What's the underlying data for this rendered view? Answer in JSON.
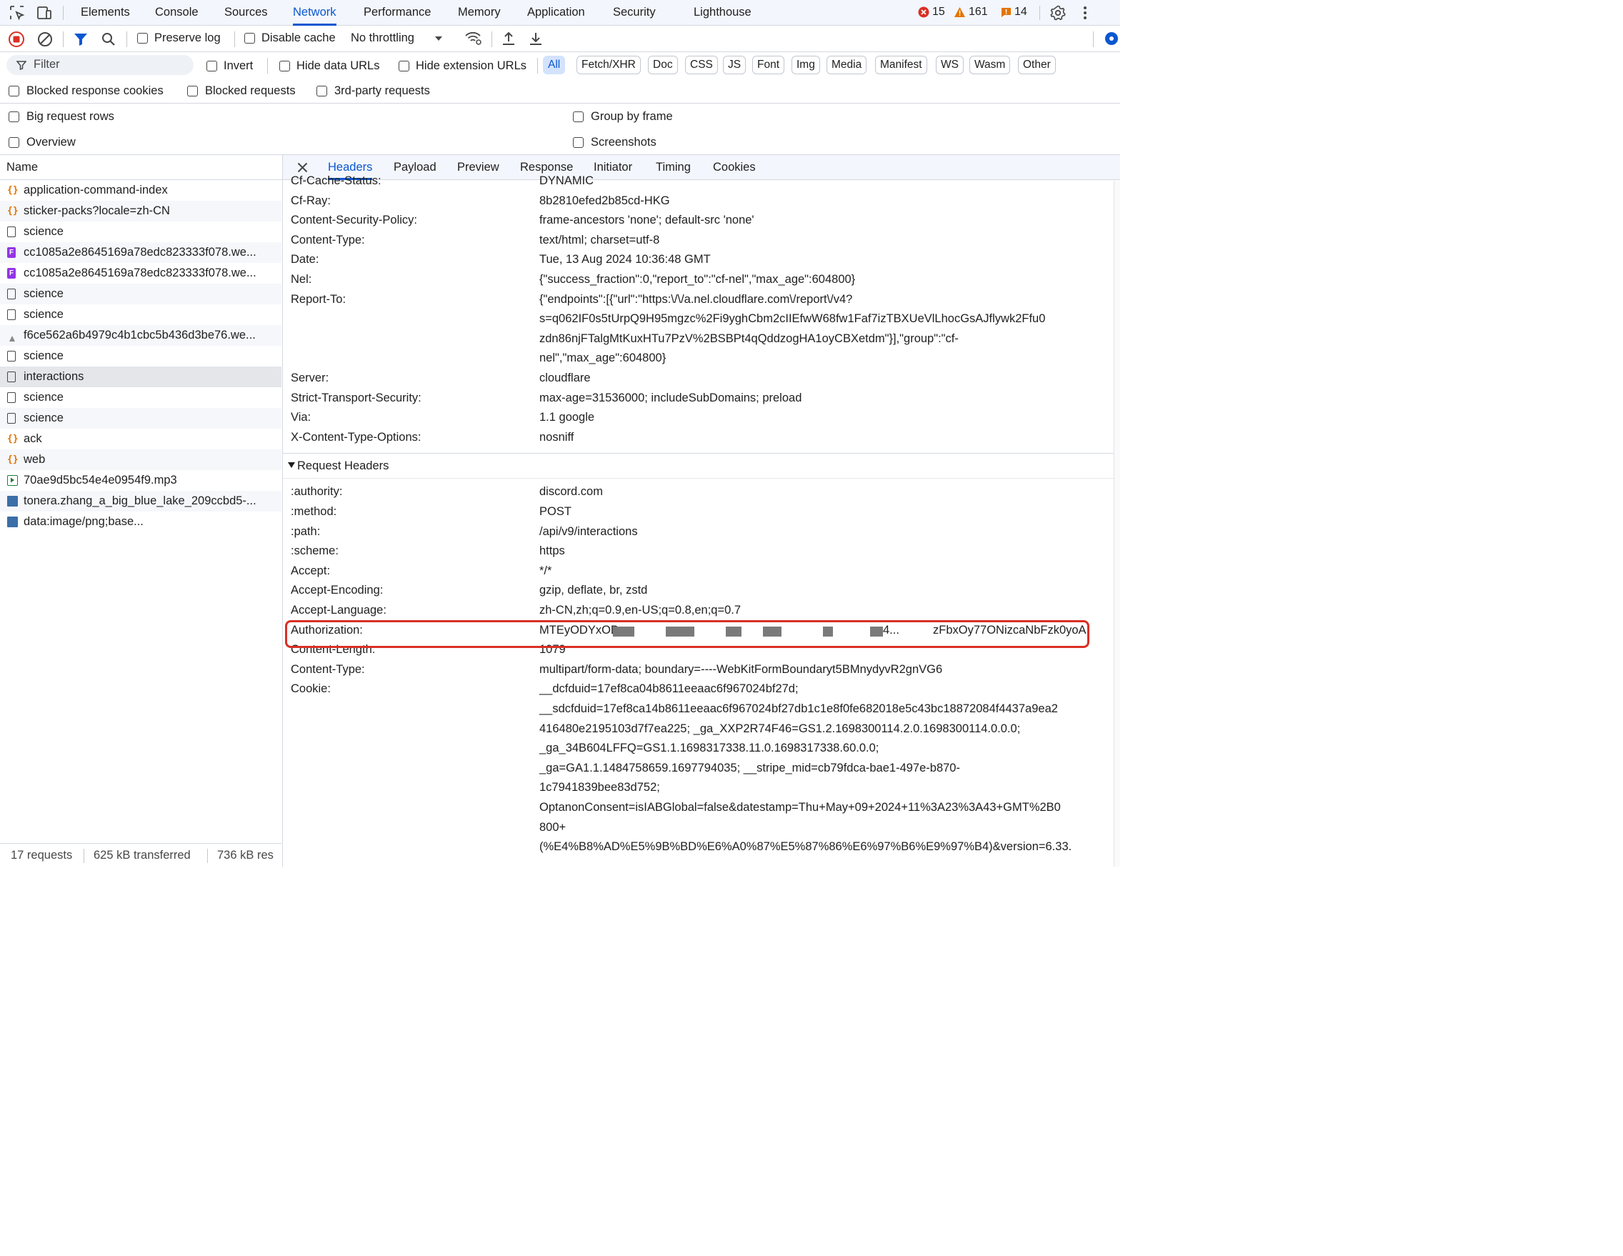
{
  "topbar": {
    "tabs": [
      "Elements",
      "Console",
      "Sources",
      "Network",
      "Performance",
      "Memory",
      "Application",
      "Security",
      "Lighthouse"
    ],
    "active_tab": "Network",
    "errors": "15",
    "warnings": "161",
    "issues": "14"
  },
  "toolbar": {
    "preserve_log": "Preserve log",
    "disable_cache": "Disable cache",
    "throttling": "No throttling"
  },
  "filter": {
    "placeholder": "Filter",
    "invert": "Invert",
    "hide_data_urls": "Hide data URLs",
    "hide_extension_urls": "Hide extension URLs",
    "types": [
      "All",
      "Fetch/XHR",
      "Doc",
      "CSS",
      "JS",
      "Font",
      "Img",
      "Media",
      "Manifest",
      "WS",
      "Wasm",
      "Other"
    ],
    "blocked_response_cookies": "Blocked response cookies",
    "blocked_requests": "Blocked requests",
    "third_party_requests": "3rd-party requests",
    "big_request_rows": "Big request rows",
    "group_by_frame": "Group by frame",
    "overview": "Overview",
    "screenshots": "Screenshots"
  },
  "requests": {
    "header": "Name",
    "items": [
      {
        "name": "application-command-index",
        "type": "xhr"
      },
      {
        "name": "sticker-packs?locale=zh-CN",
        "type": "xhr"
      },
      {
        "name": "science",
        "type": "doc"
      },
      {
        "name": "cc1085a2e8645169a78edc823333f078.we...",
        "type": "font"
      },
      {
        "name": "cc1085a2e8645169a78edc823333f078.we...",
        "type": "font"
      },
      {
        "name": "science",
        "type": "doc"
      },
      {
        "name": "science",
        "type": "doc"
      },
      {
        "name": "f6ce562a6b4979c4b1cbc5b436d3be76.we...",
        "type": "img-small"
      },
      {
        "name": "science",
        "type": "doc"
      },
      {
        "name": "interactions",
        "type": "doc"
      },
      {
        "name": "science",
        "type": "doc"
      },
      {
        "name": "science",
        "type": "doc"
      },
      {
        "name": "ack",
        "type": "xhr"
      },
      {
        "name": "web",
        "type": "xhr"
      },
      {
        "name": "70ae9d5bc54e4e0954f9.mp3",
        "type": "media"
      },
      {
        "name": "tonera.zhang_a_big_blue_lake_209ccbd5-...",
        "type": "img"
      },
      {
        "name": "data:image/png;base...",
        "type": "img"
      }
    ],
    "selected": "interactions",
    "status": {
      "requests": "17 requests",
      "transferred": "625 kB transferred",
      "resources": "736 kB res"
    }
  },
  "details": {
    "tabs": [
      "Headers",
      "Payload",
      "Preview",
      "Response",
      "Initiator",
      "Timing",
      "Cookies"
    ],
    "active_tab": "Headers",
    "response_headers": [
      {
        "k": "Cf-Cache-Status:",
        "v": [
          "DYNAMIC"
        ]
      },
      {
        "k": "Cf-Ray:",
        "v": [
          "8b2810efed2b85cd-HKG"
        ]
      },
      {
        "k": "Content-Security-Policy:",
        "v": [
          "frame-ancestors 'none'; default-src 'none'"
        ]
      },
      {
        "k": "Content-Type:",
        "v": [
          "text/html; charset=utf-8"
        ]
      },
      {
        "k": "Date:",
        "v": [
          "Tue, 13 Aug 2024 10:36:48 GMT"
        ]
      },
      {
        "k": "Nel:",
        "v": [
          "{\"success_fraction\":0,\"report_to\":\"cf-nel\",\"max_age\":604800}"
        ]
      },
      {
        "k": "Report-To:",
        "v": [
          "{\"endpoints\":[{\"url\":\"https:\\/\\/a.nel.cloudflare.com\\/report\\/v4?",
          "s=q062IF0s5tUrpQ9H95mgzc%2Fi9yghCbm2cIIEfwW68fw1Faf7izTBXUeVlLhocGsAJflywk2Ffu0",
          "zdn86njFTalgMtKuxHTu7PzV%2BSBPt4qQddzogHA1oyCBXetdm\"}],\"group\":\"cf-",
          "nel\",\"max_age\":604800}"
        ]
      },
      {
        "k": "Server:",
        "v": [
          "cloudflare"
        ]
      },
      {
        "k": "Strict-Transport-Security:",
        "v": [
          "max-age=31536000; includeSubDomains; preload"
        ]
      },
      {
        "k": "Via:",
        "v": [
          "1.1 google"
        ]
      },
      {
        "k": "X-Content-Type-Options:",
        "v": [
          "nosniff"
        ]
      }
    ],
    "request_section_title": "Request Headers",
    "request_headers": [
      {
        "k": ":authority:",
        "v": [
          "discord.com"
        ]
      },
      {
        "k": ":method:",
        "v": [
          "POST"
        ]
      },
      {
        "k": ":path:",
        "v": [
          "/api/v9/interactions"
        ]
      },
      {
        "k": ":scheme:",
        "v": [
          "https"
        ]
      },
      {
        "k": "Accept:",
        "v": [
          "*/*"
        ]
      },
      {
        "k": "Accept-Encoding:",
        "v": [
          "gzip, deflate, br, zstd"
        ]
      },
      {
        "k": "Accept-Language:",
        "v": [
          "zh-CN,zh;q=0.9,en-US;q=0.8,en;q=0.7"
        ]
      },
      {
        "k": "Authorization:",
        "v": [
          "MTEyODYxOD"
        ]
      },
      {
        "k": "Content-Length:",
        "v": [
          "1079"
        ]
      },
      {
        "k": "Content-Type:",
        "v": [
          "multipart/form-data; boundary=----WebKitFormBoundaryt5BMnydyvR2gnVG6"
        ]
      },
      {
        "k": "Cookie:",
        "v": [
          "__dcfduid=17ef8ca04b8611eeaac6f967024bf27d;",
          "__sdcfduid=17ef8ca14b8611eeaac6f967024bf27db1c1e8f0fe682018e5c43bc18872084f4437a9ea2",
          "416480e2195103d7f7ea225; _ga_XXP2R74F46=GS1.2.1698300114.2.0.1698300114.0.0.0;",
          "_ga_34B604LFFQ=GS1.1.1698317338.11.0.1698317338.60.0.0;",
          "_ga=GA1.1.1484758659.1697794035; __stripe_mid=cb79fdca-bae1-497e-b870-",
          "1c7941839bee83d752;",
          "OptanonConsent=isIABGlobal=false&datestamp=Thu+May+09+2024+11%3A23%3A43+GMT%2B0",
          "800+",
          "(%E4%B8%AD%E5%9B%BD%E6%A0%87%E5%87%86%E6%97%B6%E9%97%B4)&version=6.33."
        ]
      }
    ],
    "auth_tail": "zFbxOy77ONizcaNbFzk0yoA",
    "auth_mid": "4..."
  },
  "colors": {
    "accent": "#0b57d0",
    "error": "#d93025",
    "warning": "#e37400",
    "highlight_box": "#d93025"
  }
}
